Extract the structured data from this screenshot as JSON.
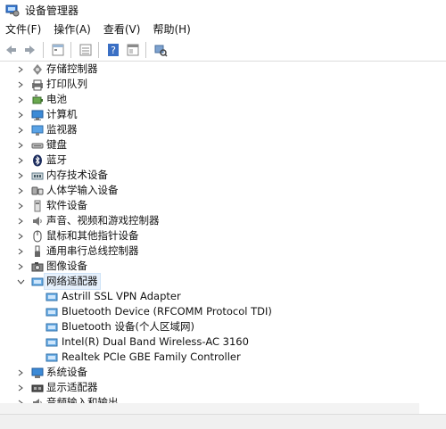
{
  "window": {
    "title": "设备管理器"
  },
  "menu": [
    {
      "label": "文件(F)"
    },
    {
      "label": "操作(A)"
    },
    {
      "label": "查看(V)"
    },
    {
      "label": "帮助(H)"
    }
  ],
  "toolbar": {
    "icons": [
      "back-arrow-icon",
      "forward-arrow-icon",
      "properties-icon",
      "list-icon",
      "help-icon",
      "panel-icon",
      "scan-hardware-icon"
    ]
  },
  "tree": {
    "categories": [
      {
        "label": "存储控制器",
        "icon": "storage-controller-icon",
        "expanded": false
      },
      {
        "label": "打印队列",
        "icon": "printer-icon",
        "expanded": false
      },
      {
        "label": "电池",
        "icon": "battery-icon",
        "expanded": false
      },
      {
        "label": "计算机",
        "icon": "computer-icon",
        "expanded": false
      },
      {
        "label": "监视器",
        "icon": "monitor-icon",
        "expanded": false
      },
      {
        "label": "键盘",
        "icon": "keyboard-icon",
        "expanded": false
      },
      {
        "label": "蓝牙",
        "icon": "bluetooth-icon",
        "expanded": false
      },
      {
        "label": "内存技术设备",
        "icon": "memory-tech-icon",
        "expanded": false
      },
      {
        "label": "人体学输入设备",
        "icon": "hid-icon",
        "expanded": false
      },
      {
        "label": "软件设备",
        "icon": "software-device-icon",
        "expanded": false
      },
      {
        "label": "声音、视频和游戏控制器",
        "icon": "speaker-icon",
        "expanded": false
      },
      {
        "label": "鼠标和其他指针设备",
        "icon": "mouse-icon",
        "expanded": false
      },
      {
        "label": "通用串行总线控制器",
        "icon": "usb-icon",
        "expanded": false
      },
      {
        "label": "图像设备",
        "icon": "camera-icon",
        "expanded": false
      },
      {
        "label": "网络适配器",
        "icon": "network-adapter-icon",
        "expanded": true,
        "selected": true,
        "children": [
          {
            "label": "Astrill SSL VPN Adapter",
            "icon": "network-adapter-icon"
          },
          {
            "label": "Bluetooth Device (RFCOMM Protocol TDI)",
            "icon": "network-adapter-icon"
          },
          {
            "label": "Bluetooth 设备(个人区域网)",
            "icon": "network-adapter-icon"
          },
          {
            "label": "Intel(R) Dual Band Wireless-AC 3160",
            "icon": "network-adapter-icon"
          },
          {
            "label": "Realtek PCIe GBE Family Controller",
            "icon": "network-adapter-icon"
          }
        ]
      },
      {
        "label": "系统设备",
        "icon": "system-device-icon",
        "expanded": false
      },
      {
        "label": "显示适配器",
        "icon": "display-adapter-icon",
        "expanded": false
      },
      {
        "label": "音频输入和输出",
        "icon": "audio-io-icon",
        "expanded": false
      }
    ]
  }
}
